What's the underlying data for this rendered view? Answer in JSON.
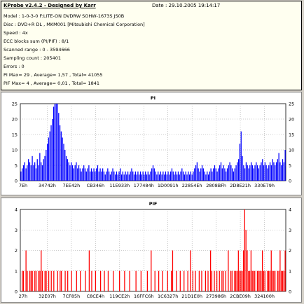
{
  "info": {
    "title": "KProbe v2.4.2 - Designed by Karr",
    "date": "Date : 29.10.2005 19:14:17",
    "lines": [
      "Model : 1-0-3-0 F:LITE-ON DVDRW SOHW-1673S JS0B",
      "Disc : DVD+R DL , MKM001 [Mitsubishi Chemical Corporation]",
      "Speed : 4x",
      "ECC blocks sum (PI/PIF) : 8/1",
      "Scanned range : 0 - 3594666",
      "Sampling count : 205401",
      "Errors : 0",
      "PI Max= 29 , Average= 1,57 , Total= 41055",
      "PIF Max= 4 , Average= 0,01 , Total= 1841"
    ]
  },
  "chart_data": [
    {
      "type": "bar",
      "title": "PI",
      "color": "#0000ff",
      "ylim": [
        0,
        25
      ],
      "yticks": [
        "0",
        "5",
        "10",
        "15",
        "20",
        "25"
      ],
      "xtick_labels": [
        "7Eh",
        "34742h",
        "7EE42h",
        "CB346h",
        "11E933h",
        "177484h",
        "1D0091h",
        "22854Eh",
        "2808BFh",
        "2D8E21h",
        "330E79h"
      ],
      "grid": true,
      "values": [
        3,
        4,
        5,
        6,
        4,
        5,
        7,
        6,
        5,
        8,
        5,
        6,
        4,
        7,
        5,
        9,
        6,
        5,
        7,
        8,
        10,
        12,
        14,
        16,
        18,
        20,
        24,
        27,
        29,
        26,
        22,
        18,
        16,
        14,
        12,
        10,
        8,
        7,
        6,
        5,
        6,
        5,
        4,
        5,
        6,
        4,
        5,
        4,
        3,
        4,
        5,
        4,
        3,
        4,
        5,
        3,
        4,
        3,
        4,
        3,
        4,
        5,
        3,
        4,
        3,
        4,
        3,
        2,
        3,
        4,
        3,
        2,
        3,
        4,
        3,
        2,
        3,
        2,
        3,
        4,
        2,
        3,
        2,
        3,
        2,
        3,
        2,
        3,
        4,
        3,
        2,
        3,
        2,
        3,
        2,
        3,
        2,
        3,
        2,
        3,
        2,
        3,
        2,
        3,
        4,
        5,
        4,
        3,
        2,
        3,
        2,
        3,
        2,
        3,
        2,
        3,
        2,
        3,
        2,
        3,
        4,
        3,
        2,
        3,
        2,
        3,
        2,
        3,
        4,
        3,
        2,
        3,
        2,
        3,
        2,
        3,
        2,
        3,
        4,
        5,
        6,
        4,
        3,
        4,
        5,
        4,
        3,
        2,
        3,
        2,
        3,
        4,
        3,
        4,
        5,
        4,
        3,
        4,
        5,
        6,
        4,
        5,
        4,
        3,
        4,
        5,
        6,
        5,
        4,
        3,
        4,
        5,
        6,
        7,
        12,
        16,
        8,
        5,
        4,
        6,
        5,
        4,
        5,
        6,
        5,
        4,
        5,
        6,
        5,
        4,
        5,
        6,
        7,
        5,
        6,
        5,
        4,
        5,
        6,
        5,
        7,
        6,
        5,
        6,
        7,
        9,
        6,
        5,
        7,
        6,
        10
      ]
    },
    {
      "type": "bar",
      "title": "PIF",
      "color": "#ff0000",
      "ylim": [
        0,
        4
      ],
      "yticks": [
        "0",
        "1",
        "2",
        "3",
        "4"
      ],
      "xtick_labels": [
        "27h",
        "32E07h",
        "7CF85h",
        "C8CE4h",
        "119CE2h",
        "16FFC6h",
        "1C6327h",
        "21D1E0h",
        "273986h",
        "2CBE09h",
        "324100h"
      ],
      "grid": true,
      "values": [
        0,
        1,
        1,
        0,
        2,
        1,
        0,
        1,
        1,
        1,
        0,
        1,
        1,
        0,
        1,
        1,
        2,
        1,
        0,
        1,
        1,
        0,
        1,
        0,
        1,
        0,
        1,
        0,
        0,
        1,
        0,
        1,
        1,
        0,
        0,
        1,
        0,
        1,
        0,
        0,
        1,
        0,
        0,
        0,
        1,
        0,
        0,
        1,
        0,
        0,
        0,
        1,
        0,
        0,
        2,
        0,
        1,
        0,
        0,
        1,
        0,
        0,
        0,
        1,
        0,
        0,
        1,
        0,
        0,
        1,
        0,
        0,
        0,
        1,
        0,
        0,
        0,
        0,
        1,
        0,
        0,
        0,
        1,
        0,
        0,
        0,
        1,
        0,
        0,
        0,
        0,
        1,
        0,
        0,
        0,
        1,
        0,
        0,
        0,
        0,
        1,
        0,
        0,
        2,
        0,
        0,
        1,
        0,
        0,
        1,
        0,
        0,
        1,
        0,
        0,
        0,
        1,
        0,
        0,
        1,
        2,
        0,
        0,
        1,
        0,
        0,
        1,
        0,
        0,
        1,
        0,
        0,
        1,
        0,
        2,
        0,
        1,
        0,
        1,
        0,
        0,
        1,
        0,
        1,
        0,
        0,
        1,
        0,
        1,
        0,
        2,
        1,
        0,
        1,
        0,
        1,
        0,
        1,
        0,
        1,
        1,
        0,
        1,
        0,
        2,
        0,
        1,
        1,
        0,
        1,
        1,
        1,
        2,
        1,
        1,
        1,
        2,
        4,
        3,
        2,
        1,
        1,
        2,
        1,
        1,
        1,
        0,
        1,
        1,
        1,
        1,
        2,
        1,
        1,
        0,
        1,
        1,
        1,
        2,
        1,
        1,
        1,
        0,
        1,
        1,
        2,
        1,
        1,
        1,
        2
      ]
    }
  ]
}
